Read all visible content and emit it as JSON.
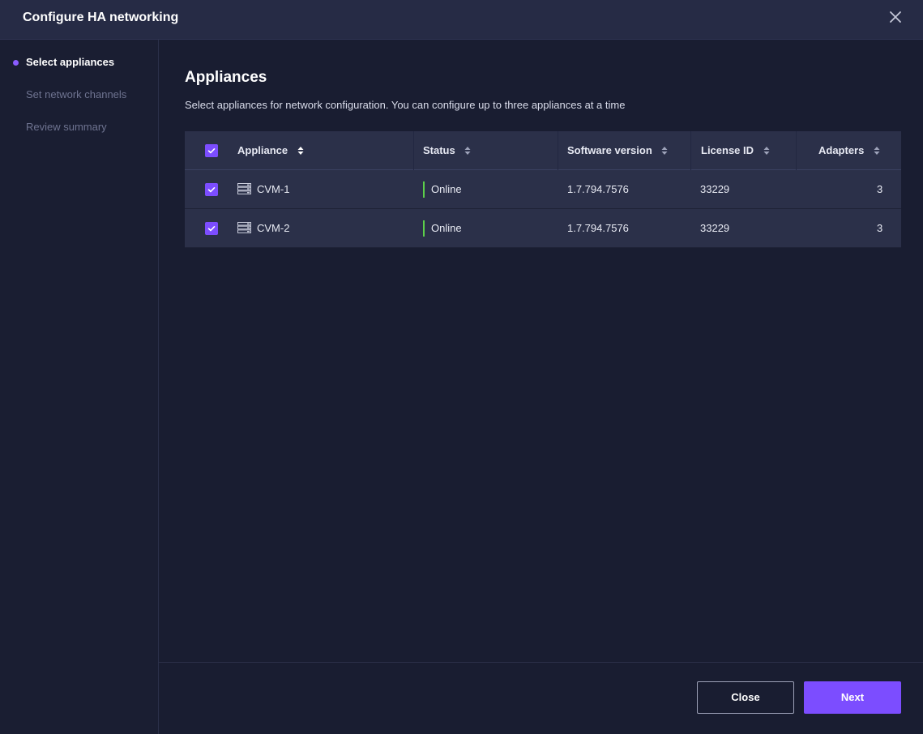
{
  "dialog": {
    "title": "Configure HA networking",
    "close_icon": "close-icon"
  },
  "steps": [
    {
      "label": "Select appliances",
      "active": true
    },
    {
      "label": "Set network channels",
      "active": false
    },
    {
      "label": "Review summary",
      "active": false
    }
  ],
  "main": {
    "heading": "Appliances",
    "subtext": "Select appliances for network configuration. You can configure up to three appliances at a time"
  },
  "table": {
    "select_all_checked": true,
    "columns": [
      "Appliance",
      "Status",
      "Software version",
      "License ID",
      "Adapters"
    ],
    "rows": [
      {
        "checked": true,
        "appliance": "CVM-1",
        "status": "Online",
        "software_version": "1.7.794.7576",
        "license_id": "33229",
        "adapters": "3"
      },
      {
        "checked": true,
        "appliance": "CVM-2",
        "status": "Online",
        "software_version": "1.7.794.7576",
        "license_id": "33229",
        "adapters": "3"
      }
    ],
    "status_color": "#5ccf4a"
  },
  "footer": {
    "close_label": "Close",
    "next_label": "Next"
  },
  "colors": {
    "accent": "#7c4dff",
    "background": "#191d31",
    "header": "#262b45"
  }
}
